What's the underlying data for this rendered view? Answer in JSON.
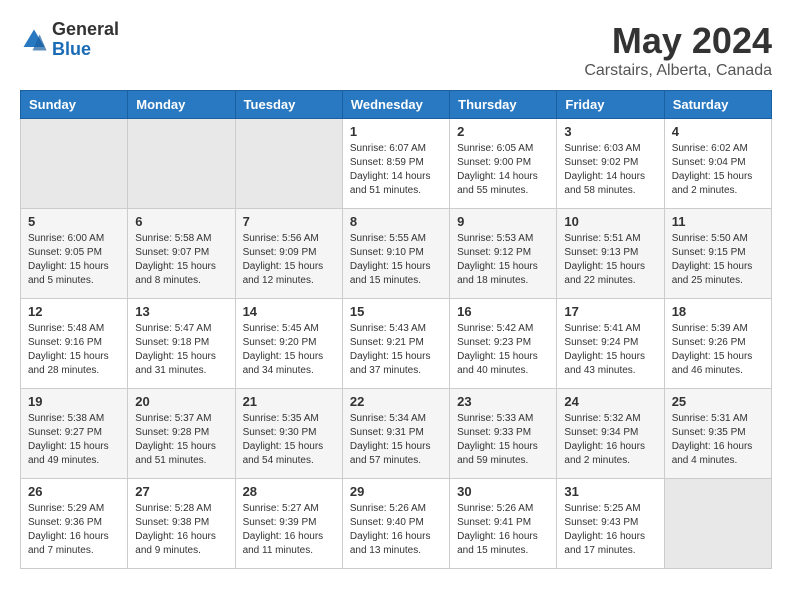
{
  "logo": {
    "general": "General",
    "blue": "Blue"
  },
  "title": "May 2024",
  "subtitle": "Carstairs, Alberta, Canada",
  "days_header": [
    "Sunday",
    "Monday",
    "Tuesday",
    "Wednesday",
    "Thursday",
    "Friday",
    "Saturday"
  ],
  "weeks": [
    [
      {
        "day": "",
        "empty": true
      },
      {
        "day": "",
        "empty": true
      },
      {
        "day": "",
        "empty": true
      },
      {
        "day": "1",
        "sunrise": "6:07 AM",
        "sunset": "8:59 PM",
        "daylight": "14 hours and 51 minutes."
      },
      {
        "day": "2",
        "sunrise": "6:05 AM",
        "sunset": "9:00 PM",
        "daylight": "14 hours and 55 minutes."
      },
      {
        "day": "3",
        "sunrise": "6:03 AM",
        "sunset": "9:02 PM",
        "daylight": "14 hours and 58 minutes."
      },
      {
        "day": "4",
        "sunrise": "6:02 AM",
        "sunset": "9:04 PM",
        "daylight": "15 hours and 2 minutes."
      }
    ],
    [
      {
        "day": "5",
        "sunrise": "6:00 AM",
        "sunset": "9:05 PM",
        "daylight": "15 hours and 5 minutes."
      },
      {
        "day": "6",
        "sunrise": "5:58 AM",
        "sunset": "9:07 PM",
        "daylight": "15 hours and 8 minutes."
      },
      {
        "day": "7",
        "sunrise": "5:56 AM",
        "sunset": "9:09 PM",
        "daylight": "15 hours and 12 minutes."
      },
      {
        "day": "8",
        "sunrise": "5:55 AM",
        "sunset": "9:10 PM",
        "daylight": "15 hours and 15 minutes."
      },
      {
        "day": "9",
        "sunrise": "5:53 AM",
        "sunset": "9:12 PM",
        "daylight": "15 hours and 18 minutes."
      },
      {
        "day": "10",
        "sunrise": "5:51 AM",
        "sunset": "9:13 PM",
        "daylight": "15 hours and 22 minutes."
      },
      {
        "day": "11",
        "sunrise": "5:50 AM",
        "sunset": "9:15 PM",
        "daylight": "15 hours and 25 minutes."
      }
    ],
    [
      {
        "day": "12",
        "sunrise": "5:48 AM",
        "sunset": "9:16 PM",
        "daylight": "15 hours and 28 minutes."
      },
      {
        "day": "13",
        "sunrise": "5:47 AM",
        "sunset": "9:18 PM",
        "daylight": "15 hours and 31 minutes."
      },
      {
        "day": "14",
        "sunrise": "5:45 AM",
        "sunset": "9:20 PM",
        "daylight": "15 hours and 34 minutes."
      },
      {
        "day": "15",
        "sunrise": "5:43 AM",
        "sunset": "9:21 PM",
        "daylight": "15 hours and 37 minutes."
      },
      {
        "day": "16",
        "sunrise": "5:42 AM",
        "sunset": "9:23 PM",
        "daylight": "15 hours and 40 minutes."
      },
      {
        "day": "17",
        "sunrise": "5:41 AM",
        "sunset": "9:24 PM",
        "daylight": "15 hours and 43 minutes."
      },
      {
        "day": "18",
        "sunrise": "5:39 AM",
        "sunset": "9:26 PM",
        "daylight": "15 hours and 46 minutes."
      }
    ],
    [
      {
        "day": "19",
        "sunrise": "5:38 AM",
        "sunset": "9:27 PM",
        "daylight": "15 hours and 49 minutes."
      },
      {
        "day": "20",
        "sunrise": "5:37 AM",
        "sunset": "9:28 PM",
        "daylight": "15 hours and 51 minutes."
      },
      {
        "day": "21",
        "sunrise": "5:35 AM",
        "sunset": "9:30 PM",
        "daylight": "15 hours and 54 minutes."
      },
      {
        "day": "22",
        "sunrise": "5:34 AM",
        "sunset": "9:31 PM",
        "daylight": "15 hours and 57 minutes."
      },
      {
        "day": "23",
        "sunrise": "5:33 AM",
        "sunset": "9:33 PM",
        "daylight": "15 hours and 59 minutes."
      },
      {
        "day": "24",
        "sunrise": "5:32 AM",
        "sunset": "9:34 PM",
        "daylight": "16 hours and 2 minutes."
      },
      {
        "day": "25",
        "sunrise": "5:31 AM",
        "sunset": "9:35 PM",
        "daylight": "16 hours and 4 minutes."
      }
    ],
    [
      {
        "day": "26",
        "sunrise": "5:29 AM",
        "sunset": "9:36 PM",
        "daylight": "16 hours and 7 minutes."
      },
      {
        "day": "27",
        "sunrise": "5:28 AM",
        "sunset": "9:38 PM",
        "daylight": "16 hours and 9 minutes."
      },
      {
        "day": "28",
        "sunrise": "5:27 AM",
        "sunset": "9:39 PM",
        "daylight": "16 hours and 11 minutes."
      },
      {
        "day": "29",
        "sunrise": "5:26 AM",
        "sunset": "9:40 PM",
        "daylight": "16 hours and 13 minutes."
      },
      {
        "day": "30",
        "sunrise": "5:26 AM",
        "sunset": "9:41 PM",
        "daylight": "16 hours and 15 minutes."
      },
      {
        "day": "31",
        "sunrise": "5:25 AM",
        "sunset": "9:43 PM",
        "daylight": "16 hours and 17 minutes."
      },
      {
        "day": "",
        "empty": true
      }
    ]
  ]
}
